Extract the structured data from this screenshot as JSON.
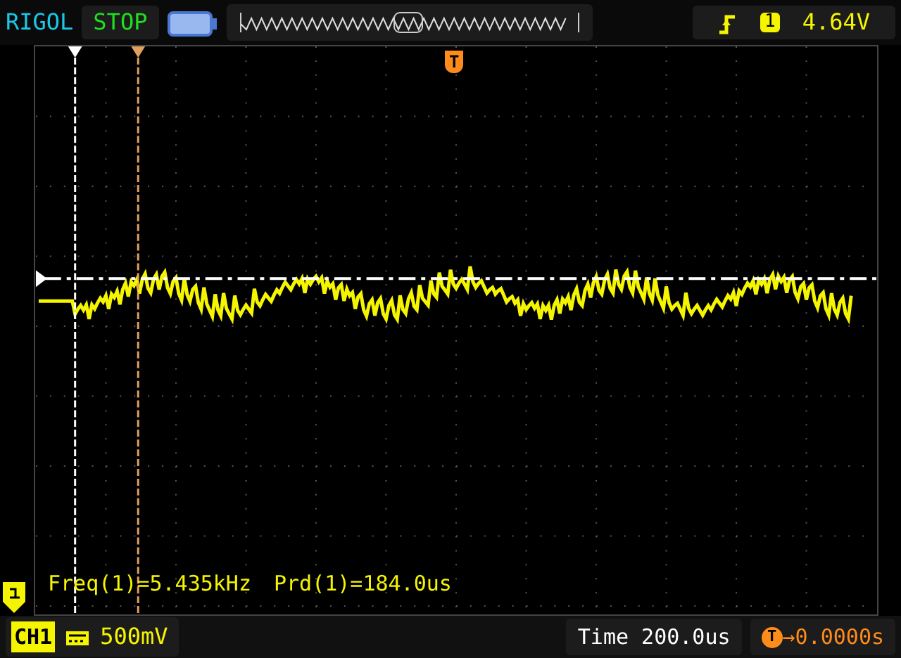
{
  "top_bar": {
    "brand": "RIGOL",
    "run_state": "STOP",
    "trigger_source": "1",
    "trigger_level": "4.64V"
  },
  "screen": {
    "trigger_marker": "T",
    "measurements": [
      "Freq(1)=5.435kHz",
      "Prd(1)=184.0us"
    ]
  },
  "bottom_bar": {
    "channel": "CH1",
    "vertical_scale": "500mV",
    "timebase": "Time 200.0us",
    "trigger_offset_label": "T",
    "trigger_offset": "→0.0000s"
  }
}
